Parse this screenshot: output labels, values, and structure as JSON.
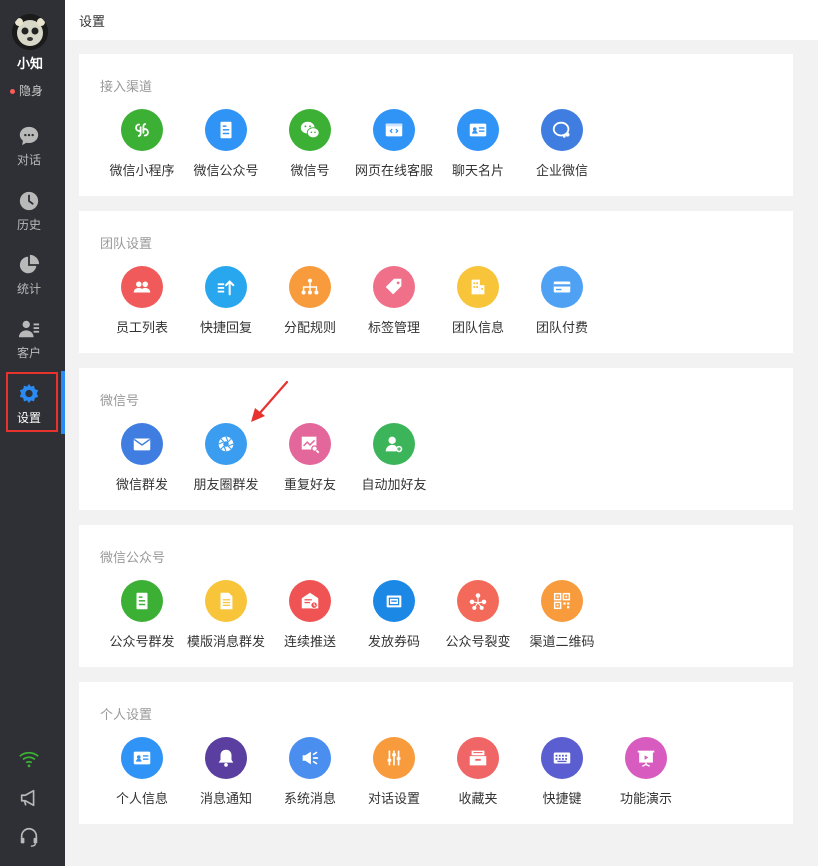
{
  "sidebar": {
    "user_name": "小知",
    "status": "隐身",
    "nav": [
      {
        "label": "对话",
        "icon": "chat-icon"
      },
      {
        "label": "历史",
        "icon": "clock-icon"
      },
      {
        "label": "统计",
        "icon": "pie-chart-icon"
      },
      {
        "label": "客户",
        "icon": "customer-icon"
      },
      {
        "label": "设置",
        "icon": "gear-icon",
        "active": true
      }
    ],
    "bottom_icons": [
      "wifi-icon",
      "megaphone-icon",
      "headset-icon"
    ]
  },
  "header": {
    "title": "设置"
  },
  "sections": [
    {
      "title": "接入渠道",
      "items": [
        {
          "label": "微信小程序",
          "icon": "miniprogram-icon",
          "color": "#3cb035"
        },
        {
          "label": "微信公众号",
          "icon": "document-icon",
          "color": "#2f94f5"
        },
        {
          "label": "微信号",
          "icon": "wechat-icon",
          "color": "#3cb035"
        },
        {
          "label": "网页在线客服",
          "icon": "webpage-code-icon",
          "color": "#2f94f5"
        },
        {
          "label": "聊天名片",
          "icon": "card-icon",
          "color": "#2f94f5"
        },
        {
          "label": "企业微信",
          "icon": "work-wechat-icon",
          "color": "#3f7ee0"
        }
      ]
    },
    {
      "title": "团队设置",
      "items": [
        {
          "label": "员工列表",
          "icon": "users-icon",
          "color": "#f05a5a"
        },
        {
          "label": "快捷回复",
          "icon": "quick-reply-icon",
          "color": "#29a7ee"
        },
        {
          "label": "分配规则",
          "icon": "hierarchy-icon",
          "color": "#f89b3c"
        },
        {
          "label": "标签管理",
          "icon": "tag-icon",
          "color": "#f0708a"
        },
        {
          "label": "团队信息",
          "icon": "building-icon",
          "color": "#f7c43a"
        },
        {
          "label": "团队付费",
          "icon": "credit-card-icon",
          "color": "#4fa2f3"
        }
      ]
    },
    {
      "title": "微信号",
      "items": [
        {
          "label": "微信群发",
          "icon": "mail-icon",
          "color": "#3f7ee0"
        },
        {
          "label": "朋友圈群发",
          "icon": "aperture-icon",
          "color": "#3a9df0"
        },
        {
          "label": "重复好友",
          "icon": "chart-search-icon",
          "color": "#e3679b"
        },
        {
          "label": "自动加好友",
          "icon": "add-friend-icon",
          "color": "#3cb55a"
        }
      ]
    },
    {
      "title": "微信公众号",
      "items": [
        {
          "label": "公众号群发",
          "icon": "article-icon",
          "color": "#3cb035"
        },
        {
          "label": "模版消息群发",
          "icon": "template-doc-icon",
          "color": "#f7c43a"
        },
        {
          "label": "连续推送",
          "icon": "scheduled-push-icon",
          "color": "#ef5353"
        },
        {
          "label": "发放券码",
          "icon": "coupon-icon",
          "color": "#1b88e6"
        },
        {
          "label": "公众号裂变",
          "icon": "fission-icon",
          "color": "#f46a5a"
        },
        {
          "label": "渠道二维码",
          "icon": "qrcode-icon",
          "color": "#f89b3c"
        }
      ]
    },
    {
      "title": "个人设置",
      "items": [
        {
          "label": "个人信息",
          "icon": "id-card-icon",
          "color": "#2f94f5"
        },
        {
          "label": "消息通知",
          "icon": "bell-icon",
          "color": "#5a3fa0"
        },
        {
          "label": "系统消息",
          "icon": "broadcast-icon",
          "color": "#4a8ff0"
        },
        {
          "label": "对话设置",
          "icon": "sliders-icon",
          "color": "#f89b3c"
        },
        {
          "label": "收藏夹",
          "icon": "inbox-icon",
          "color": "#f06565"
        },
        {
          "label": "快捷键",
          "icon": "keyboard-icon",
          "color": "#5a5ed0"
        },
        {
          "label": "功能演示",
          "icon": "presentation-icon",
          "color": "#d85cc0"
        }
      ]
    }
  ]
}
